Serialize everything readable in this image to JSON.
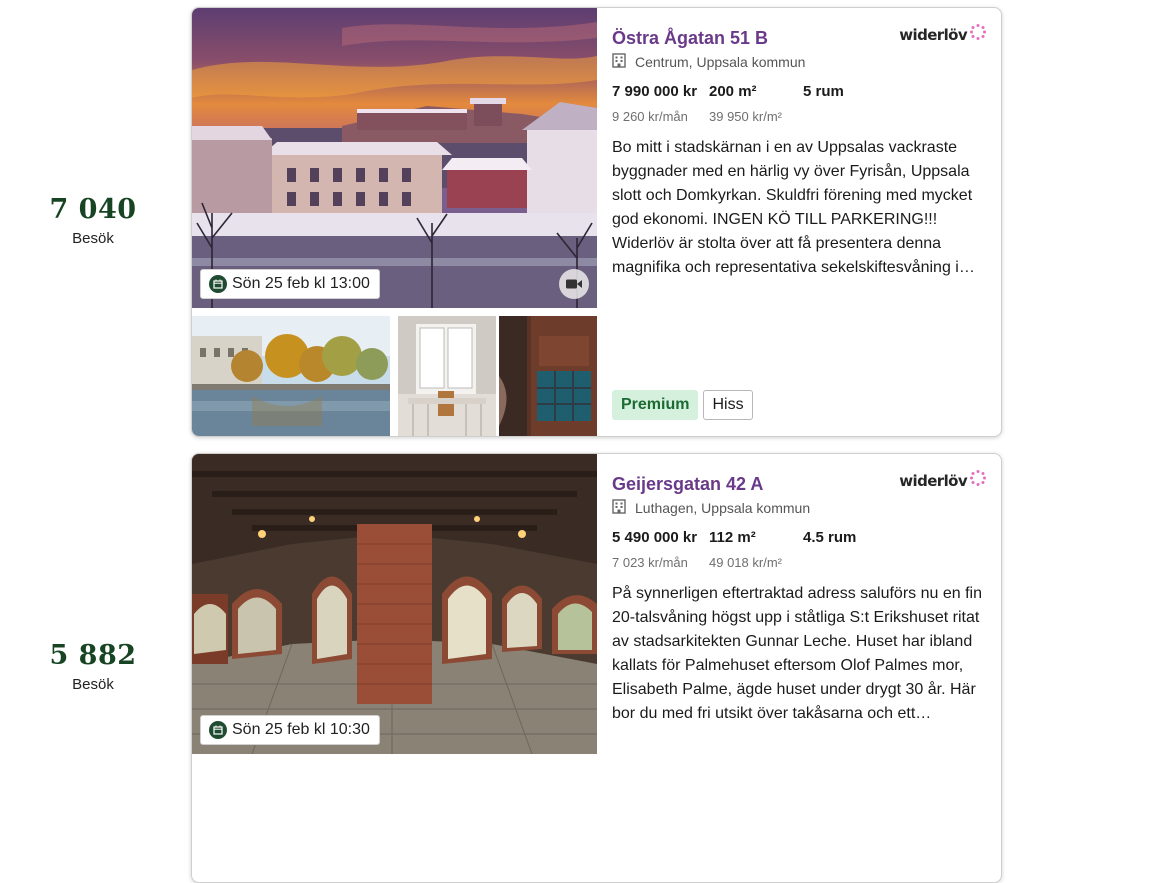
{
  "listings": [
    {
      "visits": "7 040",
      "visits_label": "Besök",
      "address": "Östra Ågatan 51 B",
      "area": "Centrum, Uppsala kommun",
      "broker": "widerlöv",
      "price": "7 990 000 kr",
      "size": "200 m²",
      "rooms": "5 rum",
      "fee": "9 260 kr/mån",
      "price_per_m2": "39 950 kr/m²",
      "description": "Bo mitt i stadskärnan i en av Uppsalas vackraste byggnader med en härlig vy över Fyrisån, Uppsala slott och Domkyrkan. Skuldfri förening med mycket god ekonomi.   INGEN KÖ TILL PARKERING!!! Widerlöv är stolta över att få presentera denna magnifika och representativa sekelskiftesvåning i…",
      "showing": "Sön 25 feb kl 13:00",
      "tags": [
        "Premium",
        "Hiss"
      ]
    },
    {
      "visits": "5 882",
      "visits_label": "Besök",
      "address": "Geijersgatan 42 A",
      "area": "Luthagen, Uppsala kommun",
      "broker": "widerlöv",
      "price": "5 490 000 kr",
      "size": "112 m²",
      "rooms": "4.5 rum",
      "fee": "7 023 kr/mån",
      "price_per_m2": "49 018 kr/m²",
      "description": "På synnerligen eftertraktad adress saluförs nu en fin 20-talsvåning högst upp i ståtliga S:t Erikshuset ritat av stadsarkitekten Gunnar Leche. Huset har ibland kallats för Palmehuset eftersom Olof Palmes mor, Elisabeth Palme, ägde huset under drygt 30 år. Här bor du med fri utsikt över takåsarna och ett…",
      "showing": "Sön 25 feb kl 10:30"
    }
  ],
  "colors": {
    "address": "#6a3a8a",
    "visits": "#174523",
    "premium_bg": "#d6f0de",
    "premium_text": "#1c6b33",
    "logo_accent": "#e36fc0"
  },
  "icons": [
    "calendar-icon",
    "video-icon",
    "building-icon",
    "widerlov-flower-icon"
  ]
}
